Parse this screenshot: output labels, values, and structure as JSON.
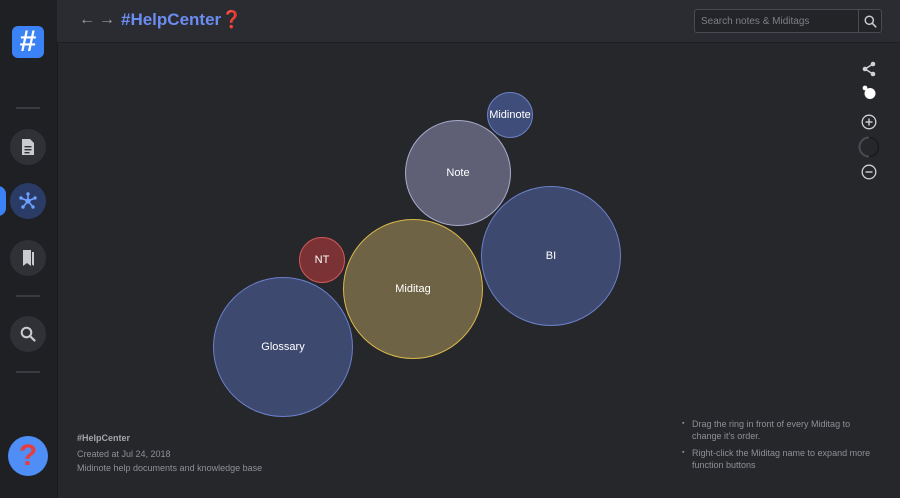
{
  "sidebar": {
    "logo_glyph": "#",
    "items": [
      {
        "name": "notes",
        "icon": "document-icon"
      },
      {
        "name": "graph",
        "icon": "graph-icon",
        "active": true
      },
      {
        "name": "bookmarks",
        "icon": "bookmark-icon"
      },
      {
        "name": "search",
        "icon": "search-icon"
      }
    ],
    "help_glyph": "?"
  },
  "header": {
    "title": "#HelpCenter",
    "title_suffix": "❓",
    "search_placeholder": "Search notes & Miditags"
  },
  "graph": {
    "nodes": [
      {
        "label": "Midinote",
        "color": "#3f4d7a"
      },
      {
        "label": "Note",
        "color": "#5f6076"
      },
      {
        "label": "NT",
        "color": "#7a3235"
      },
      {
        "label": "BI",
        "color": "#3e4970"
      },
      {
        "label": "Miditag",
        "color": "#6e6445"
      },
      {
        "label": "Glossary",
        "color": "#3e4970"
      }
    ]
  },
  "info": {
    "name": "#HelpCenter",
    "created": "Created at Jul 24, 2018",
    "description": "Midinote help documents and knowledge base"
  },
  "tips": [
    "Drag the ring in front of every Miditag to change it's order.",
    "Right-click the Miditag name to expand more function buttons"
  ],
  "colors": {
    "accent": "#3b82f6",
    "title": "#6b8cf0",
    "background": "#26272b"
  }
}
